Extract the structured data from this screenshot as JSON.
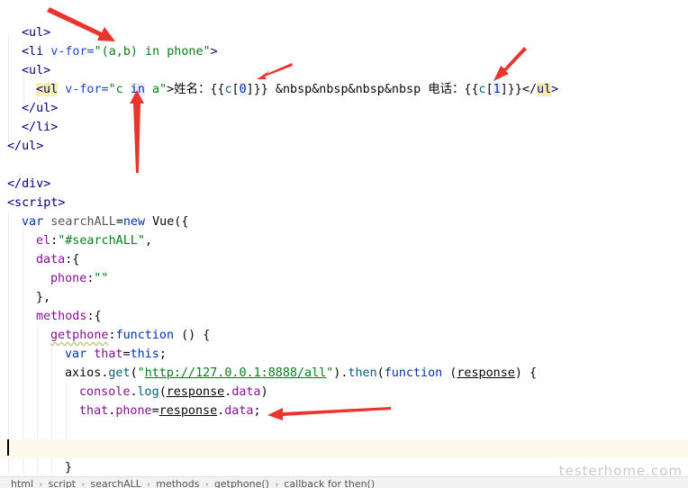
{
  "code": {
    "line_top_partial": "          v    ,          ,         ",
    "l1": [
      "<ul>"
    ],
    "l2": [
      "<li",
      " v-for=",
      "\"(a,b) in phone\"",
      ">"
    ],
    "l3": [
      "<ul>"
    ],
    "l4": [
      "<ul",
      " v-for=",
      "\"c ",
      "in",
      " a\"",
      ">姓名：{{",
      "c",
      "[",
      "0",
      "]}} &nbsp&nbsp&nbsp&nbsp 电话：{{",
      "c",
      "[",
      "1",
      "]}}</",
      "ul",
      ">"
    ],
    "l5": [
      "</ul>"
    ],
    "l6": [
      "</li>"
    ],
    "l7": [
      "</ul>"
    ],
    "l8": [
      "</div>"
    ],
    "l9": [
      "<script>"
    ],
    "l10": [
      "var ",
      "searchALL",
      "=",
      "new ",
      "Vue({"
    ],
    "l11": [
      "el",
      ":",
      "\"#searchALL\"",
      ","
    ],
    "l12": [
      "data",
      ":{"
    ],
    "l13": [
      "phone",
      ":",
      "\"\""
    ],
    "l14": [
      "},"
    ],
    "l15": [
      "methods",
      ":{"
    ],
    "l16": [
      "getphone",
      ":",
      "function ",
      "() {"
    ],
    "l17": [
      "var ",
      "that",
      "=",
      "this",
      ";"
    ],
    "l18": [
      "axios",
      ".",
      "get",
      "(",
      "\"",
      "http://127.0.0.1:8888/all",
      "\"",
      ").",
      "then",
      "(",
      "function ",
      "(",
      "response",
      ") {"
    ],
    "l19": [
      "console",
      ".",
      "log",
      "(",
      "response",
      ".",
      "data",
      ")"
    ],
    "l20": [
      "that",
      ".",
      "phone",
      "=",
      "response",
      ".",
      "data",
      ";"
    ],
    "l22": [
      "}"
    ]
  },
  "statusbar": [
    "html",
    "script",
    "searchALL",
    "methods",
    "getphone()",
    "callback for then()"
  ],
  "watermark": "testerhome.com",
  "colors": {
    "arrow": "#e8352e",
    "bg": "#ffffff",
    "current_line": "#fcfaed"
  }
}
